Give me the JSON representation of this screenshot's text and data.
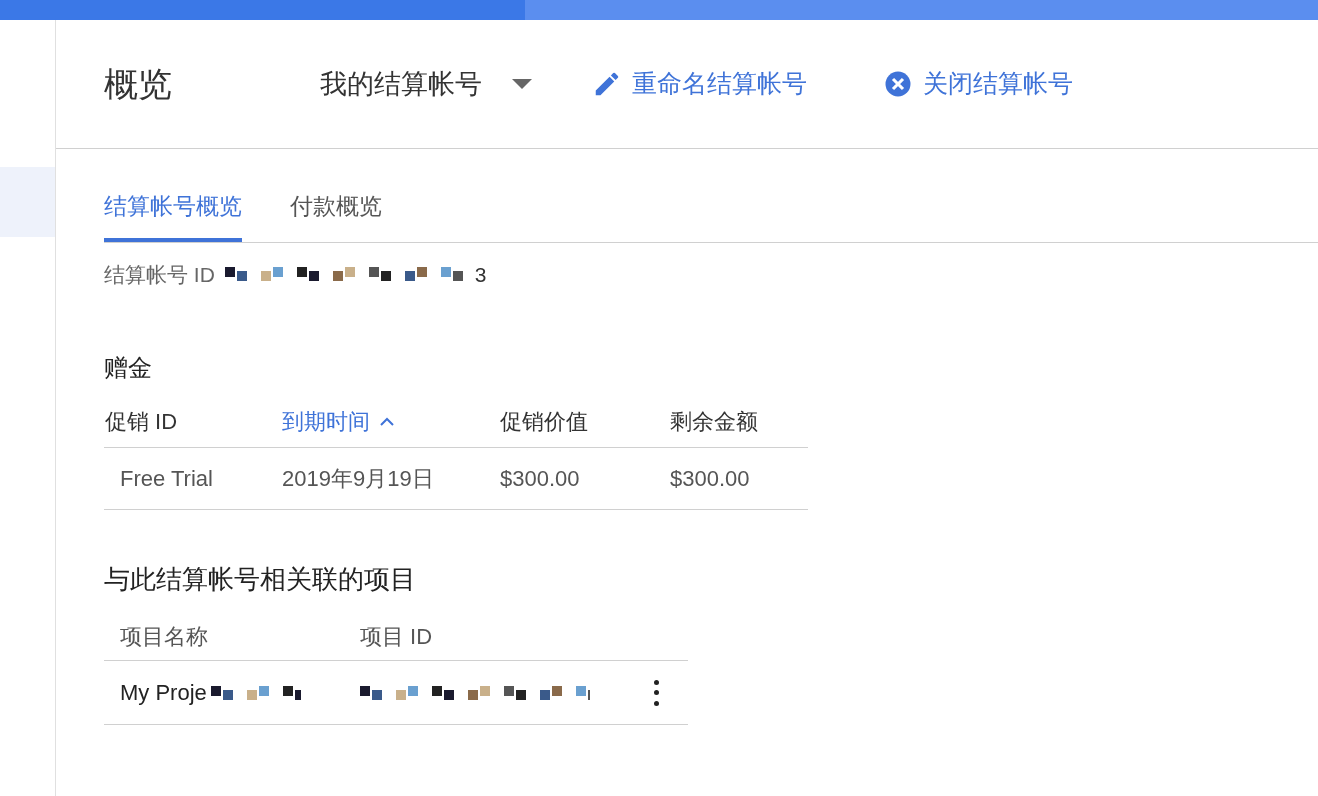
{
  "header": {
    "title": "概览",
    "account_selector": "我的结算帐号",
    "actions": [
      {
        "kind": "edit",
        "label": "重命名结算帐号"
      },
      {
        "kind": "close",
        "label": "关闭结算帐号"
      }
    ]
  },
  "tabs": [
    {
      "label": "结算帐号概览",
      "selected": true
    },
    {
      "label": "付款概览",
      "selected": false
    }
  ],
  "billing_id": {
    "label": "结算帐号 ID",
    "value_tail": "3"
  },
  "credits": {
    "title": "赠金",
    "columns": [
      {
        "label": "促销 ID",
        "sorted": false
      },
      {
        "label": "到期时间",
        "sorted": true
      },
      {
        "label": "促销价值",
        "sorted": false
      },
      {
        "label": "剩余金额",
        "sorted": false
      }
    ],
    "rows": [
      [
        "Free Trial",
        "2019年9月19日",
        "$300.00",
        "$300.00"
      ]
    ]
  },
  "projects": {
    "title": "与此结算帐号相关联的项目",
    "columns": [
      "项目名称",
      "项目 ID"
    ],
    "rows": [
      {
        "name": "My Proje"
      }
    ]
  }
}
